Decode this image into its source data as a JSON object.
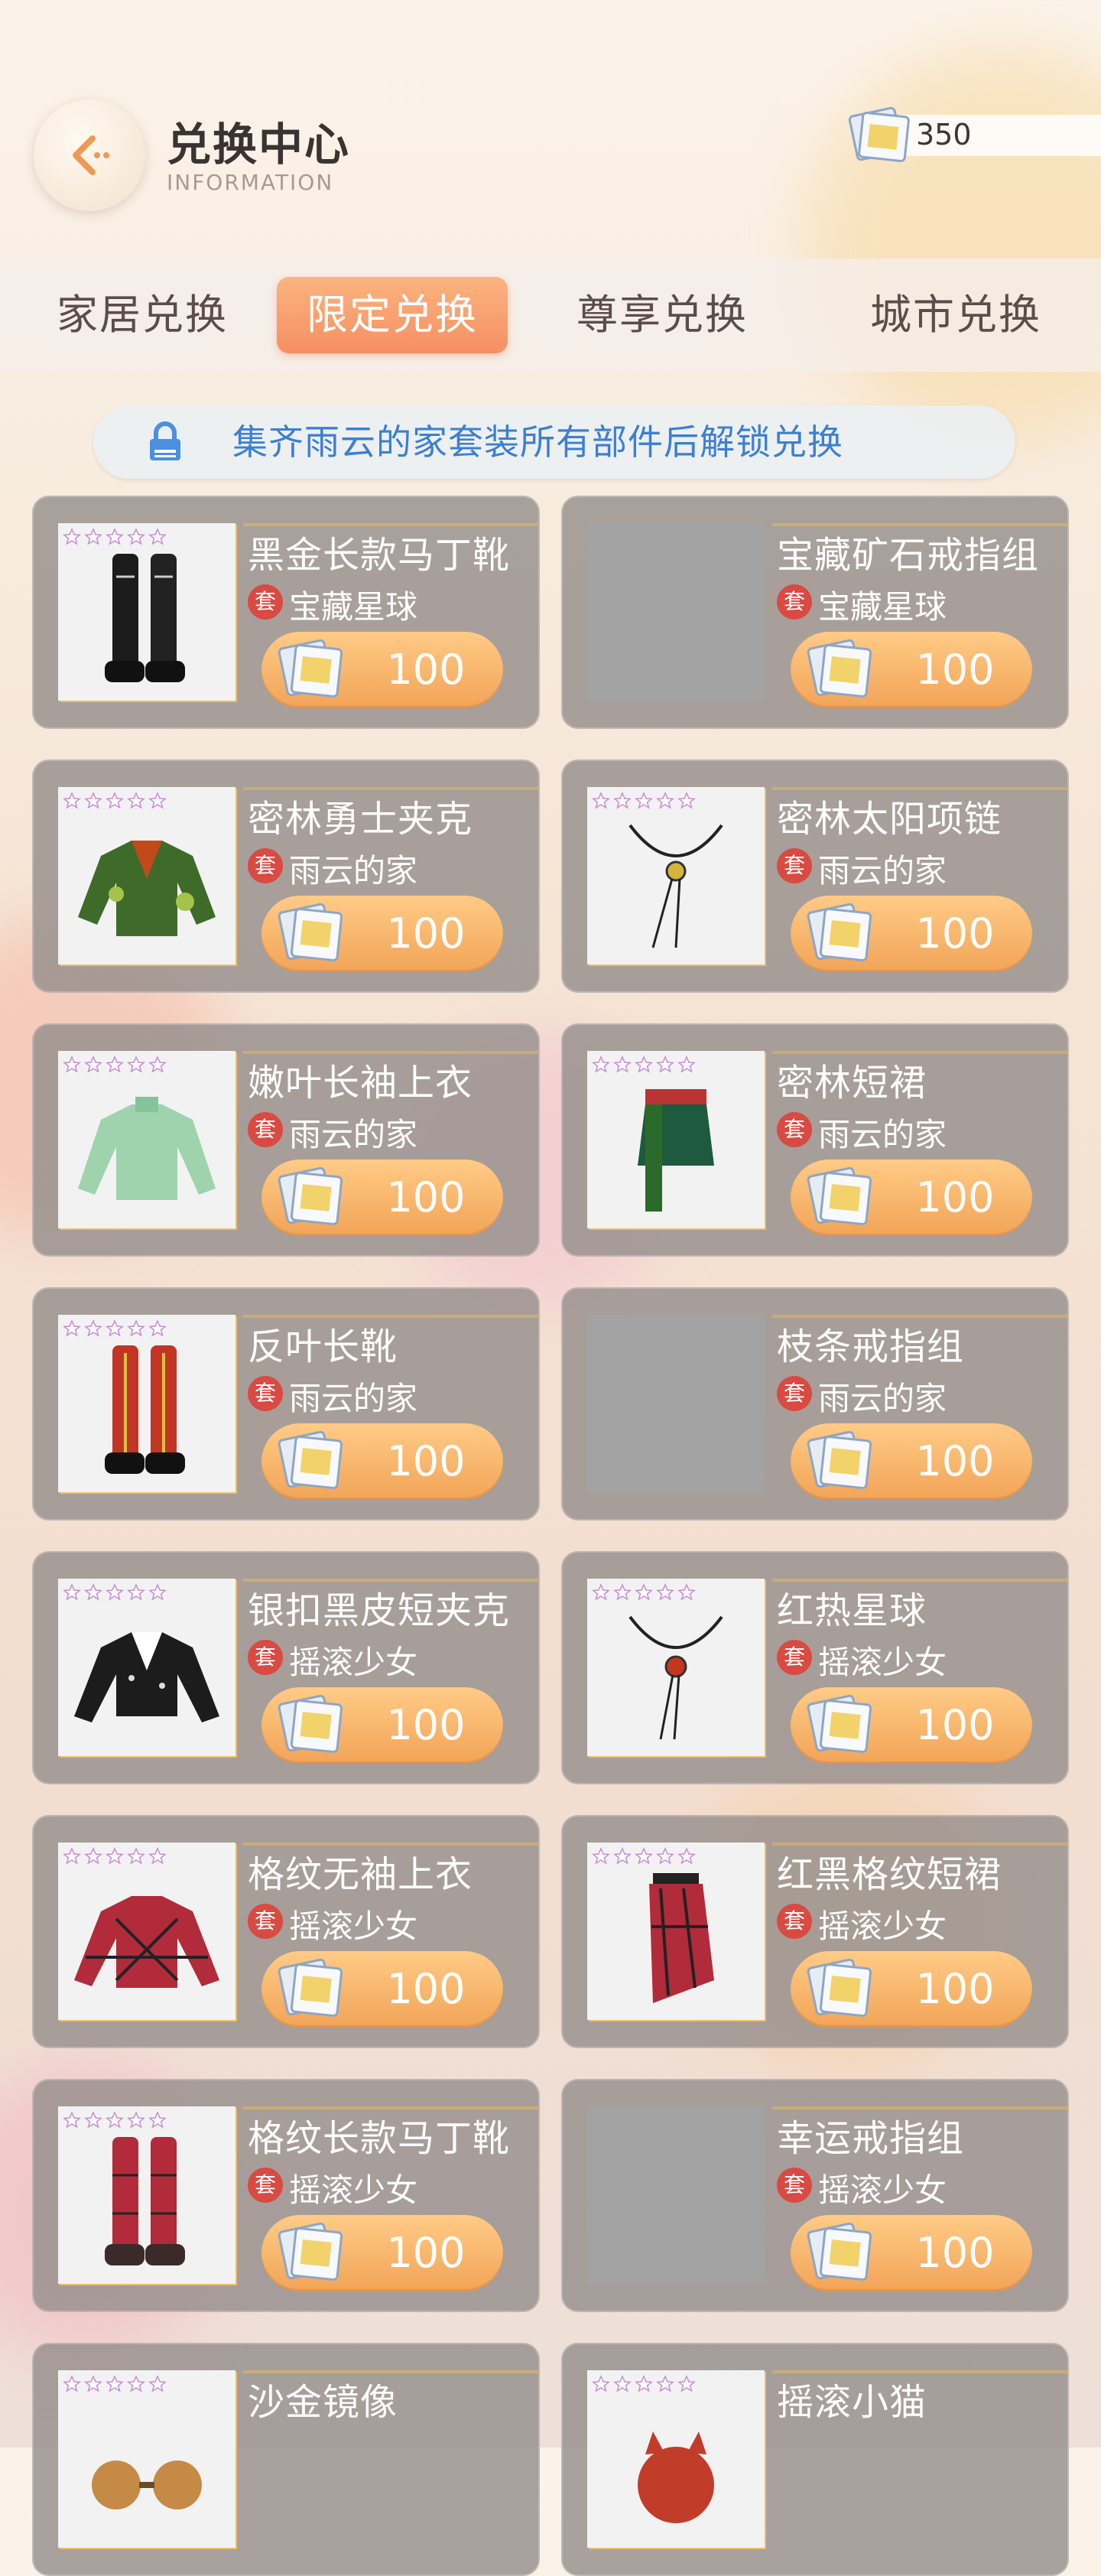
{
  "header": {
    "title": "兑换中心",
    "subtitle": "INFORMATION",
    "currency": "350"
  },
  "tabs": [
    {
      "label": "家居兑换",
      "active": false
    },
    {
      "label": "限定兑换",
      "active": true
    },
    {
      "label": "尊享兑换",
      "active": false
    },
    {
      "label": "城市兑换",
      "active": false
    }
  ],
  "notice": {
    "text": "集齐雨云的家套装所有部件后解锁兑换"
  },
  "set_icon_label": "套",
  "colors": {
    "accent": "#f58f63",
    "notice_text": "#3c7fd3",
    "set_badge": "#d94a42"
  },
  "items": [
    {
      "name": "黑金长款马丁靴",
      "set": "宝藏星球",
      "price": "100",
      "art": "boots-black-icon"
    },
    {
      "name": "宝藏矿石戒指组",
      "set": "宝藏星球",
      "price": "100",
      "art": "blank"
    },
    {
      "name": "密林勇士夹克",
      "set": "雨云的家",
      "price": "100",
      "art": "jacket-camo-icon"
    },
    {
      "name": "密林太阳项链",
      "set": "雨云的家",
      "price": "100",
      "art": "necklace-icon"
    },
    {
      "name": "嫩叶长袖上衣",
      "set": "雨云的家",
      "price": "100",
      "art": "top-green-icon"
    },
    {
      "name": "密林短裙",
      "set": "雨云的家",
      "price": "100",
      "art": "skirt-green-icon"
    },
    {
      "name": "反叶长靴",
      "set": "雨云的家",
      "price": "100",
      "art": "boots-red-icon"
    },
    {
      "name": "枝条戒指组",
      "set": "雨云的家",
      "price": "100",
      "art": "blank"
    },
    {
      "name": "银扣黑皮短夹克",
      "set": "摇滚少女",
      "price": "100",
      "art": "jacket-black-icon"
    },
    {
      "name": "红热星球",
      "set": "摇滚少女",
      "price": "100",
      "art": "necklace-red-icon"
    },
    {
      "name": "格纹无袖上衣",
      "set": "摇滚少女",
      "price": "100",
      "art": "top-plaid-icon"
    },
    {
      "name": "红黑格纹短裙",
      "set": "摇滚少女",
      "price": "100",
      "art": "skirt-plaid-icon"
    },
    {
      "name": "格纹长款马丁靴",
      "set": "摇滚少女",
      "price": "100",
      "art": "boots-plaid-icon"
    },
    {
      "name": "幸运戒指组",
      "set": "摇滚少女",
      "price": "100",
      "art": "blank"
    },
    {
      "name": "沙金镜像",
      "set": "",
      "price": "",
      "art": "glasses-icon"
    },
    {
      "name": "摇滚小猫",
      "set": "",
      "price": "",
      "art": "cat-icon"
    }
  ]
}
